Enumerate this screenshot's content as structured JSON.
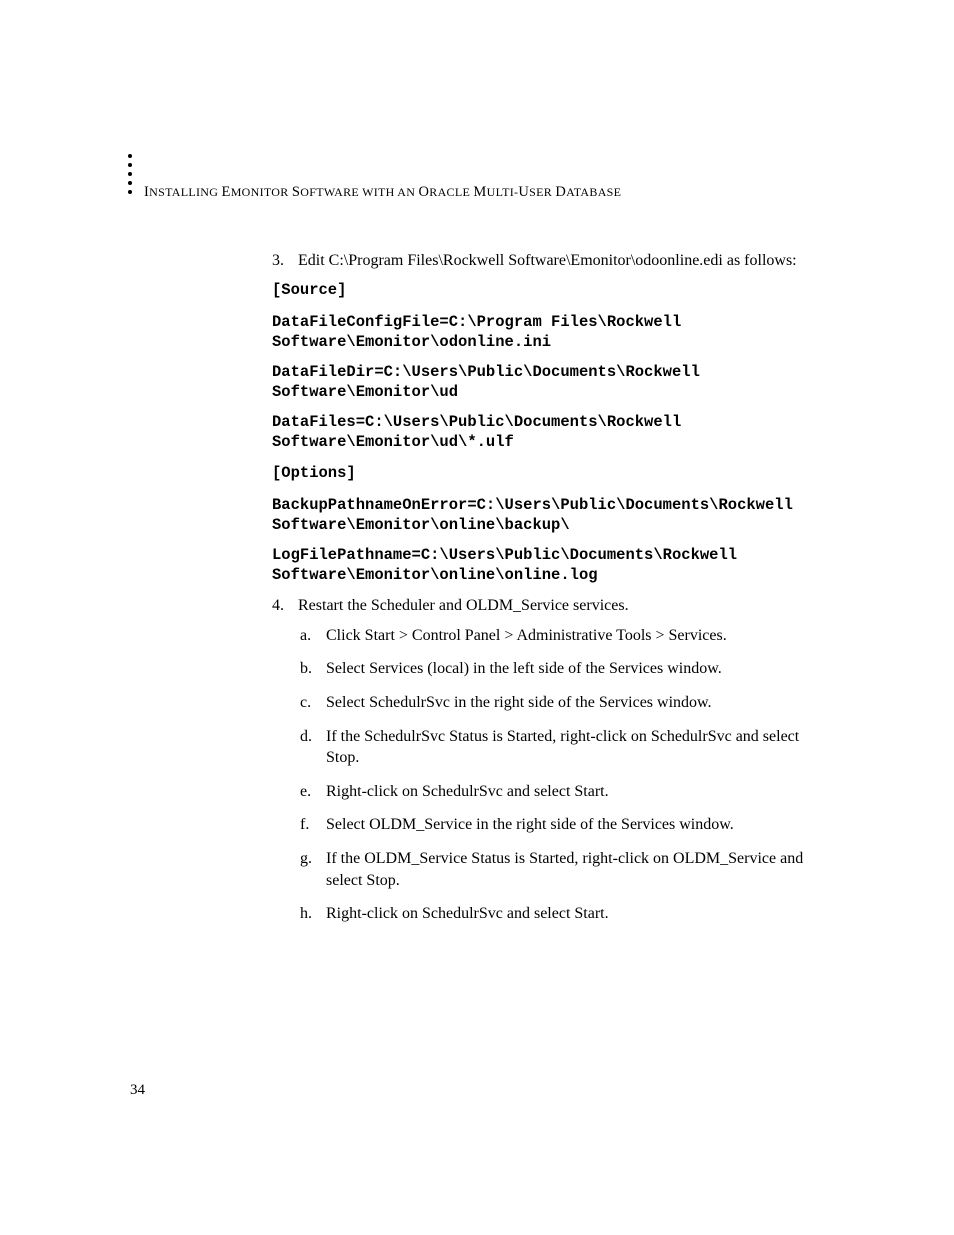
{
  "header": {
    "partA": "I",
    "partA2": "NSTALLING ",
    "partB": "E",
    "partB2": "MONITOR ",
    "partC": "S",
    "partC2": "OFTWARE WITH AN ",
    "partD": "O",
    "partD2": "RACLE ",
    "partE": "M",
    "partE2": "ULTI-",
    "partF": "U",
    "partF2": "SER ",
    "partG": "D",
    "partG2": "ATABASE"
  },
  "step3": {
    "num": "3.",
    "text": "Edit C:\\Program Files\\Rockwell Software\\Emonitor\\odoonline.edi as follows:"
  },
  "code": {
    "l1": "[Source]",
    "l2a": "DataFileConfigFile=C:\\Program Files\\Rockwell",
    "l2b": "Software\\Emonitor\\odonline.ini",
    "l3a": "DataFileDir=C:\\Users\\Public\\Documents\\Rockwell",
    "l3b": "Software\\Emonitor\\ud",
    "l4a": "DataFiles=C:\\Users\\Public\\Documents\\Rockwell",
    "l4b": "Software\\Emonitor\\ud\\*.ulf",
    "l5": "[Options]",
    "l6a": "BackupPathnameOnError=C:\\Users\\Public\\Documents\\Rockwell",
    "l6b": "Software\\Emonitor\\online\\backup\\",
    "l7a": "LogFilePathname=C:\\Users\\Public\\Documents\\Rockwell",
    "l7b": "Software\\Emonitor\\online\\online.log"
  },
  "step4": {
    "num": "4.",
    "text": "Restart the Scheduler and OLDM_Service services."
  },
  "sub": {
    "a": {
      "l": "a.",
      "t": "Click Start > Control Panel > Administrative Tools > Services."
    },
    "b": {
      "l": "b.",
      "t": "Select Services (local) in the left side of the Services window."
    },
    "c": {
      "l": "c.",
      "t": "Select SchedulrSvc in the right side of the Services window."
    },
    "d": {
      "l": "d.",
      "t": "If the SchedulrSvc Status is Started, right-click on SchedulrSvc and select Stop."
    },
    "e": {
      "l": "e.",
      "t": "Right-click on SchedulrSvc and select Start."
    },
    "f": {
      "l": "f.",
      "t": "Select OLDM_Service in the right side of the Services window."
    },
    "g": {
      "l": "g.",
      "t": "If the OLDM_Service Status is Started, right-click on OLDM_Service and select Stop."
    },
    "h": {
      "l": "h.",
      "t": "Right-click on SchedulrSvc and select Start."
    }
  },
  "pageNumber": "34"
}
